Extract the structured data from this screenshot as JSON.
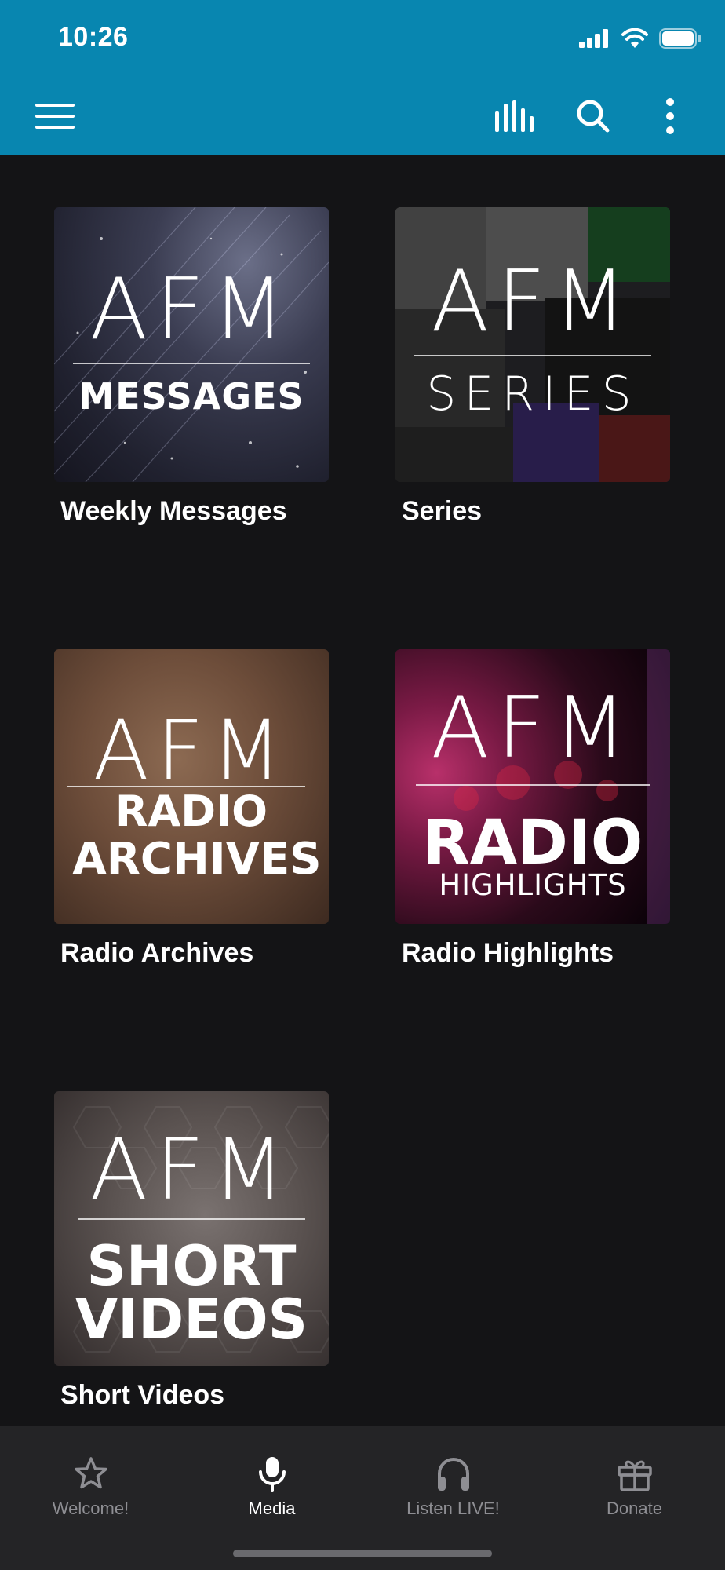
{
  "status": {
    "time": "10:26"
  },
  "toolbar": {
    "menu": "menu-icon",
    "player": "audio-bars-icon",
    "search": "search-icon",
    "more": "more-vertical-icon"
  },
  "tiles": [
    {
      "title": "Weekly Messages",
      "art_brand": "AFM",
      "art_sub": "MESSAGES"
    },
    {
      "title": "Series",
      "art_brand": "AFM",
      "art_sub": "SERIES"
    },
    {
      "title": "Radio Archives",
      "art_brand": "AFM",
      "art_sub_line1": "RADIO",
      "art_sub_line2": "ARCHIVES"
    },
    {
      "title": "Radio Highlights",
      "art_brand": "AFM",
      "art_sub_line1": "RADIO",
      "art_sub_line2": "HIGHLIGHTS"
    },
    {
      "title": "Short Videos",
      "art_brand": "AFM",
      "art_sub_line1": "SHORT",
      "art_sub_line2": "VIDEOS"
    }
  ],
  "nav": [
    {
      "label": "Welcome!",
      "icon": "star-icon"
    },
    {
      "label": "Media",
      "icon": "microphone-icon",
      "active": true
    },
    {
      "label": "Listen LIVE!",
      "icon": "headphones-icon"
    },
    {
      "label": "Donate",
      "icon": "gift-icon"
    }
  ],
  "colors": {
    "accent": "#0886b0",
    "background": "#141416",
    "nav_bg": "#242426"
  }
}
